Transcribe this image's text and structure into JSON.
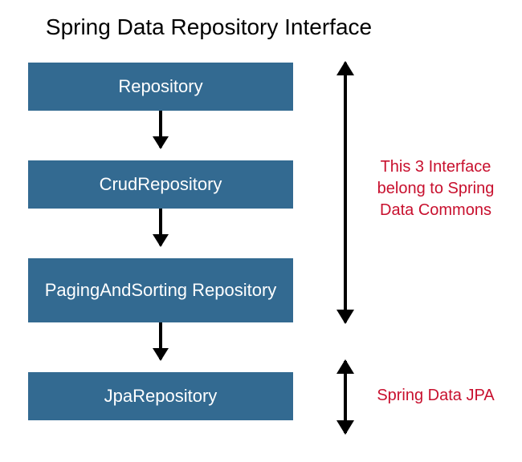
{
  "title": "Spring Data Repository Interface",
  "boxes": {
    "repository": "Repository",
    "crud": "CrudRepository",
    "paging": "PagingAndSorting Repository",
    "jpa": "JpaRepository"
  },
  "sideLabels": {
    "commons": "This 3 Interface belong to Spring Data Commons",
    "jpa": "Spring Data JPA"
  },
  "colors": {
    "boxFill": "#336a91",
    "boxText": "#ffffff",
    "accentText": "#c8102e"
  }
}
